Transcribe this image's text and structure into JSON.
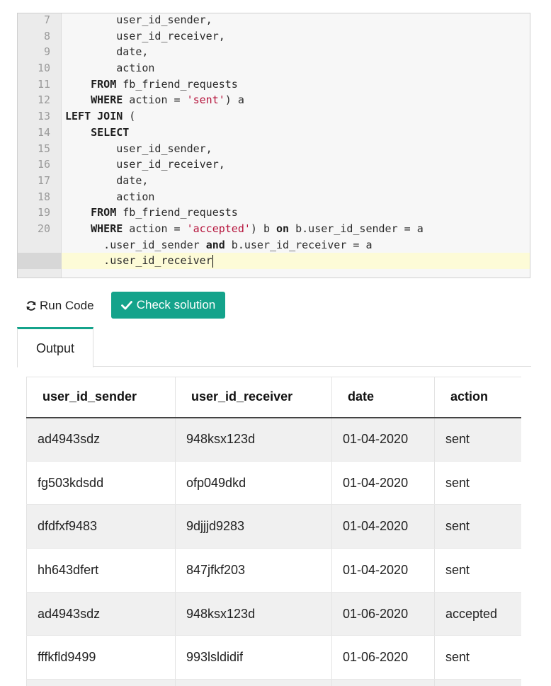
{
  "editor": {
    "lines": [
      {
        "num": "7",
        "segments": [
          {
            "t": "        user_id_sender,",
            "c": ""
          }
        ]
      },
      {
        "num": "8",
        "segments": [
          {
            "t": "        user_id_receiver,",
            "c": ""
          }
        ]
      },
      {
        "num": "9",
        "segments": [
          {
            "t": "        date,",
            "c": ""
          }
        ]
      },
      {
        "num": "10",
        "segments": [
          {
            "t": "        action",
            "c": ""
          }
        ]
      },
      {
        "num": "11",
        "segments": [
          {
            "t": "    ",
            "c": ""
          },
          {
            "t": "FROM",
            "c": "kw"
          },
          {
            "t": " fb_friend_requests",
            "c": ""
          }
        ]
      },
      {
        "num": "12",
        "segments": [
          {
            "t": "    ",
            "c": ""
          },
          {
            "t": "WHERE",
            "c": "kw"
          },
          {
            "t": " action = ",
            "c": ""
          },
          {
            "t": "'sent'",
            "c": "str"
          },
          {
            "t": ") a",
            "c": ""
          }
        ]
      },
      {
        "num": "13",
        "segments": [
          {
            "t": "LEFT JOIN",
            "c": "kw"
          },
          {
            "t": " (",
            "c": ""
          }
        ]
      },
      {
        "num": "14",
        "segments": [
          {
            "t": "    ",
            "c": ""
          },
          {
            "t": "SELECT",
            "c": "kw"
          }
        ]
      },
      {
        "num": "15",
        "segments": [
          {
            "t": "        user_id_sender,",
            "c": ""
          }
        ]
      },
      {
        "num": "16",
        "segments": [
          {
            "t": "        user_id_receiver,",
            "c": ""
          }
        ]
      },
      {
        "num": "17",
        "segments": [
          {
            "t": "        date,",
            "c": ""
          }
        ]
      },
      {
        "num": "18",
        "segments": [
          {
            "t": "        action",
            "c": ""
          }
        ]
      },
      {
        "num": "19",
        "segments": [
          {
            "t": "    ",
            "c": ""
          },
          {
            "t": "FROM",
            "c": "kw"
          },
          {
            "t": " fb_friend_requests",
            "c": ""
          }
        ]
      },
      {
        "num": "20",
        "active": true,
        "segments": [
          {
            "t": "    ",
            "c": ""
          },
          {
            "t": "WHERE",
            "c": "kw"
          },
          {
            "t": " action = ",
            "c": ""
          },
          {
            "t": "'accepted'",
            "c": "str"
          },
          {
            "t": ") b ",
            "c": ""
          },
          {
            "t": "on",
            "c": "kw"
          },
          {
            "t": " b.user_id_sender = a",
            "c": ""
          }
        ]
      },
      {
        "num": "",
        "active": true,
        "segments": [
          {
            "t": "      .user_id_sender ",
            "c": ""
          },
          {
            "t": "and",
            "c": "kw"
          },
          {
            "t": " b.user_id_receiver = a",
            "c": ""
          }
        ]
      },
      {
        "num": "",
        "active": true,
        "highlight": true,
        "cursor": true,
        "segments": [
          {
            "t": "      .user_id_receiver",
            "c": ""
          }
        ]
      }
    ]
  },
  "toolbar": {
    "run_label": "Run Code",
    "check_label": "Check solution",
    "accent_color": "#14a38b"
  },
  "tabs": [
    {
      "label": "Output"
    }
  ],
  "table": {
    "columns": [
      "user_id_sender",
      "user_id_receiver",
      "date",
      "action"
    ],
    "rows": [
      [
        "ad4943sdz",
        "948ksx123d",
        "01-04-2020",
        "sent"
      ],
      [
        "fg503kdsdd",
        "ofp049dkd",
        "01-04-2020",
        "sent"
      ],
      [
        "dfdfxf9483",
        "9djjjd9283",
        "01-04-2020",
        "sent"
      ],
      [
        "hh643dfert",
        "847jfkf203",
        "01-04-2020",
        "sent"
      ],
      [
        "ad4943sdz",
        "948ksx123d",
        "01-06-2020",
        "accepted"
      ],
      [
        "fffkfld9499",
        "993lsldidif",
        "01-06-2020",
        "sent"
      ]
    ]
  }
}
